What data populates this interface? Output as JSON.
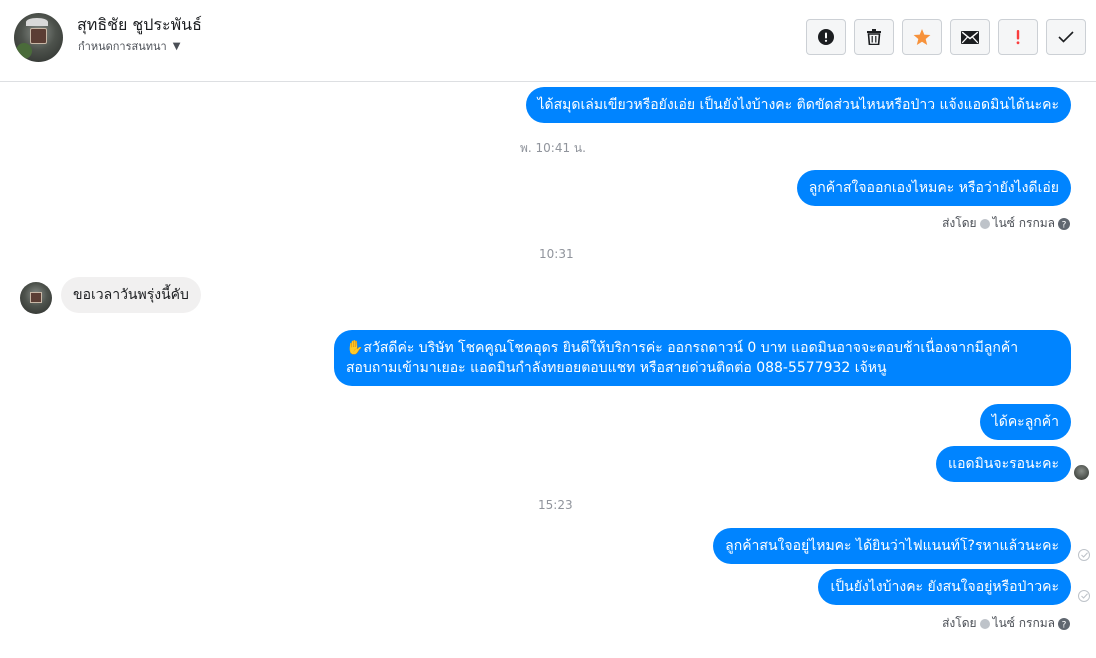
{
  "header": {
    "contact_name": "สุทธิชัย ชูประพันธ์",
    "label": "กำหนดการสนทนา",
    "caret": "▼",
    "actions": [
      {
        "name": "spam-button",
        "icon": "alert-circle-icon"
      },
      {
        "name": "delete-button",
        "icon": "trash-icon"
      },
      {
        "name": "star-button",
        "icon": "star-icon",
        "color": "#f7923b"
      },
      {
        "name": "mail-button",
        "icon": "envelope-icon"
      },
      {
        "name": "important-button",
        "icon": "exclamation-icon",
        "color": "#fa3e3e"
      },
      {
        "name": "done-button",
        "icon": "checkmark-icon"
      }
    ]
  },
  "colors": {
    "outgoing": "#0084ff",
    "incoming": "#f1f0f0"
  },
  "messages": {
    "m1": "ได้สมุดเล่มเขียวหรือยังเอ่ย เป็นยังไงบ้างคะ ติดขัดส่วนไหนหรือป่าว แจ้งแอดมินได้นะคะ",
    "ts1": "พ. 10:41 น.",
    "m2": "ลูกค้าสใจออกเองไหมคะ หรือว่ายังไงดีเอ่ย",
    "sent_by_1": "ส่งโดย",
    "sender_1": "ไนซ์ กรกมล",
    "ts2": "10:31",
    "m3": "ขอเวลาวันพรุ่งนี้คับ",
    "m4": "✋สวัสดีค่ะ บริษัท โชคคูณโชคอุดร ยินดีให้บริการค่ะ ออกรถดาวน์ 0 บาท แอดมินอาจจะตอบช้าเนื่องจากมีลูกค้าสอบถามเข้ามาเยอะ แอดมินกำลังทยอยตอบแชท หรือสายด่วนติดต่อ 088-5577932 เจ้หนู",
    "m5": "ได้คะลูกค้า",
    "m6": "แอดมินจะรอนะคะ",
    "ts3": "15:23",
    "m7": "ลูกค้าสนใจอยู่ไหมคะ ได้ยินว่าไฟแนนท์โ?รหาแล้วนะคะ",
    "m8": "เป็นยังไงบ้างคะ ยังสนใจอยู่หรือป่าวคะ",
    "sent_by_2": "ส่งโดย",
    "sender_2": "ไนซ์ กรกมล"
  }
}
